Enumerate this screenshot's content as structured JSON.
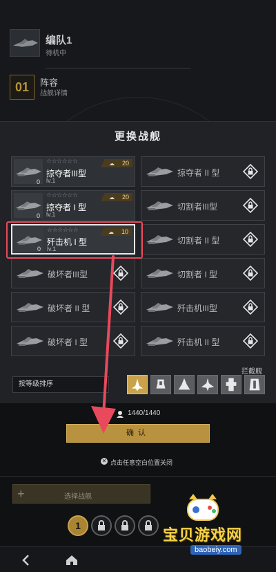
{
  "background": {
    "fleet_name": "编队1",
    "fleet_status": "待机中",
    "lineup_number": "01",
    "lineup_title": "阵容",
    "lineup_subtitle": "战舰详情"
  },
  "modal": {
    "title": "更换战舰",
    "ships": [
      {
        "name": "掠夺者III型",
        "level": "lv.1",
        "count": "0",
        "cost": "20",
        "stars": "☆☆☆☆☆☆",
        "locked": false,
        "selected": false
      },
      {
        "name": "掠夺者 II 型",
        "locked": true
      },
      {
        "name": "掠夺者 I 型",
        "level": "lv.1",
        "count": "0",
        "cost": "20",
        "stars": "☆☆☆☆☆☆",
        "locked": false,
        "selected": false
      },
      {
        "name": "切割者III型",
        "locked": true
      },
      {
        "name": "歼击机 I 型",
        "level": "lv.1",
        "count": "0",
        "cost": "10",
        "stars": "☆☆☆☆☆☆",
        "locked": false,
        "selected": true
      },
      {
        "name": "切割者 II 型",
        "locked": true
      },
      {
        "name": "破坏者III型",
        "locked": true
      },
      {
        "name": "切割者 I 型",
        "locked": true
      },
      {
        "name": "破坏者 II 型",
        "locked": true
      },
      {
        "name": "歼击机III型",
        "locked": true
      },
      {
        "name": "破坏者 I 型",
        "locked": true
      },
      {
        "name": "歼击机 II 型",
        "locked": true
      }
    ],
    "sort_label": "按等级排序",
    "filter_label": "拦截舰",
    "filter_icons": [
      "fighter-class-icon",
      "destroyer-class-icon",
      "cruiser-class-icon",
      "battlecruiser-class-icon",
      "carrier-class-icon",
      "battleship-class-icon"
    ]
  },
  "capacity": "1440/1440",
  "confirm_label": "确认",
  "close_hint": "点击任意空白位置关闭",
  "select_ship_label": "选择战舰",
  "pager": {
    "current": "1"
  },
  "watermark": {
    "title": "宝贝游戏网",
    "url": "baobeiy.com"
  },
  "colors": {
    "accent_gold": "#b8923f",
    "highlight_red": "#e8495c",
    "panel": "#202226"
  }
}
